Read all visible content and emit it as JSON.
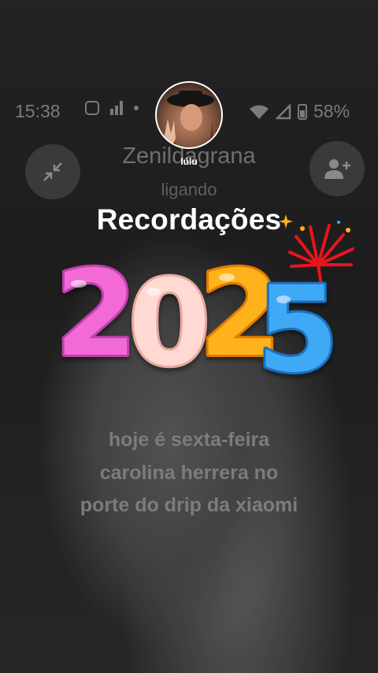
{
  "status_bar": {
    "time": "15:38",
    "battery": "58%"
  },
  "call": {
    "contact_name": "Zenildagrana",
    "status": "ligando"
  },
  "profile": {
    "name": "lúlu"
  },
  "title": "Recordações",
  "sticker": {
    "year": "2025",
    "digits": [
      "2",
      "0",
      "2",
      "5"
    ]
  },
  "caption": [
    "hoje é sexta-feira",
    "carolina herrera no",
    "porte do drip da xiaomi"
  ],
  "colors": {
    "pink": "#f26ad6",
    "cream": "#ffd9d2",
    "orange": "#ffb21c",
    "blue": "#3fa9f5",
    "firework": "#e8141c"
  },
  "icons": [
    "instagram-icon",
    "signal-bars-icon",
    "wifi-icon",
    "cell-signal-icon",
    "battery-icon",
    "minimize-icon",
    "add-person-icon",
    "firework-icon",
    "sparkle-icon"
  ]
}
